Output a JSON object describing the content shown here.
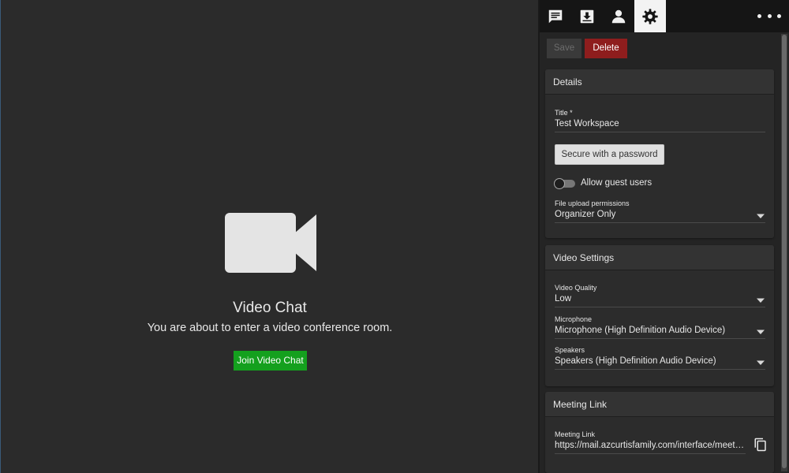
{
  "main": {
    "title": "Video Chat",
    "subtitle": "You are about to enter a video conference room.",
    "join_label": "Join Video Chat",
    "icon": "video-camera-icon"
  },
  "tabs": [
    {
      "icon": "chat-icon"
    },
    {
      "icon": "download-icon"
    },
    {
      "icon": "person-icon"
    },
    {
      "icon": "gear-icon",
      "active": true
    }
  ],
  "more_icon": "more-horizontal-icon",
  "actions": {
    "save_label": "Save",
    "delete_label": "Delete"
  },
  "details": {
    "header": "Details",
    "title_label": "Title *",
    "title_value": "Test Workspace",
    "password_button": "Secure with a password",
    "guest_label": "Allow guest users",
    "guest_enabled": false,
    "upload_label": "File upload permissions",
    "upload_value": "Organizer Only"
  },
  "video": {
    "header": "Video Settings",
    "quality_label": "Video Quality",
    "quality_value": "Low",
    "mic_label": "Microphone",
    "mic_value": "Microphone (High Definition Audio Device)",
    "speakers_label": "Speakers",
    "speakers_value": "Speakers (High Definition Audio Device)"
  },
  "meeting": {
    "header": "Meeting Link",
    "link_label": "Meeting Link",
    "link_value": "https://mail.azcurtisfamily.com/interface/meeting/test-workspace"
  },
  "colors": {
    "join_green": "#14a01e",
    "delete_red": "#8e1d1d",
    "active_tab": "#f3f3f3"
  }
}
